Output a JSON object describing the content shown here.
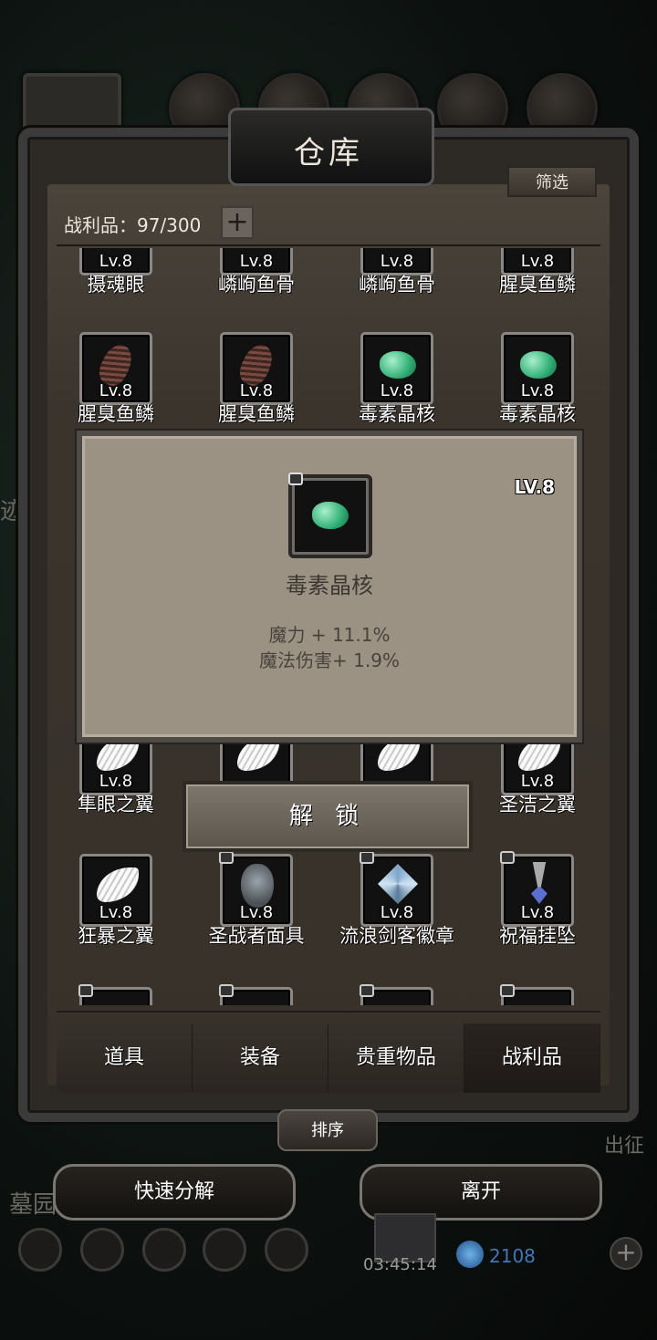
{
  "window": {
    "title": "仓库",
    "filter_label": "筛选"
  },
  "loot": {
    "label": "战利品：97/300",
    "plus": "+"
  },
  "grid": {
    "rows": [
      [
        {
          "name": "摄魂眼",
          "lv": "Lv.8"
        },
        {
          "name": "嶙峋鱼骨",
          "lv": "Lv.8"
        },
        {
          "name": "嶙峋鱼骨",
          "lv": "Lv.8"
        },
        {
          "name": "腥臭鱼鳞",
          "lv": "Lv.8"
        }
      ],
      [
        {
          "name": "腥臭鱼鳞",
          "lv": "Lv.8",
          "icon": "scale-icon"
        },
        {
          "name": "腥臭鱼鳞",
          "lv": "Lv.8",
          "icon": "scale-icon"
        },
        {
          "name": "毒素晶核",
          "lv": "Lv.8",
          "icon": "gem-icon"
        },
        {
          "name": "毒素晶核",
          "lv": "Lv.8",
          "icon": "gem-icon"
        }
      ],
      [
        {
          "name": "隼眼之翼",
          "lv": "Lv.8",
          "icon": "wing-icon"
        },
        {
          "name": "",
          "lv": "",
          "icon": "wing-icon"
        },
        {
          "name": "",
          "lv": "",
          "icon": "wing-icon"
        },
        {
          "name": "圣洁之翼",
          "lv": "Lv.8",
          "icon": "wing-icon"
        }
      ],
      [
        {
          "name": "狂暴之翼",
          "lv": "Lv.8",
          "icon": "wing-icon"
        },
        {
          "name": "圣战者面具",
          "lv": "Lv.8",
          "icon": "mask-icon"
        },
        {
          "name": "流浪剑客徽章",
          "lv": "Lv.8",
          "icon": "badge-icon"
        },
        {
          "name": "祝福挂坠",
          "lv": "Lv.8",
          "icon": "pendant-icon"
        }
      ]
    ]
  },
  "popup": {
    "level": "LV.8",
    "name": "毒素晶核",
    "stat1": "魔力 + 11.1%",
    "stat2": "魔法伤害+ 1.9%",
    "unlock_label": "解 锁"
  },
  "tabs": [
    "道具",
    "装备",
    "贵重物品",
    "战利品"
  ],
  "sort_label": "排序",
  "bottom": {
    "decompose": "快速分解",
    "leave": "离开"
  },
  "hud": {
    "timer": "03:45:14",
    "gems": "2108",
    "left_text1": "迹",
    "left_text2": "墓园",
    "right_text": "出征"
  }
}
